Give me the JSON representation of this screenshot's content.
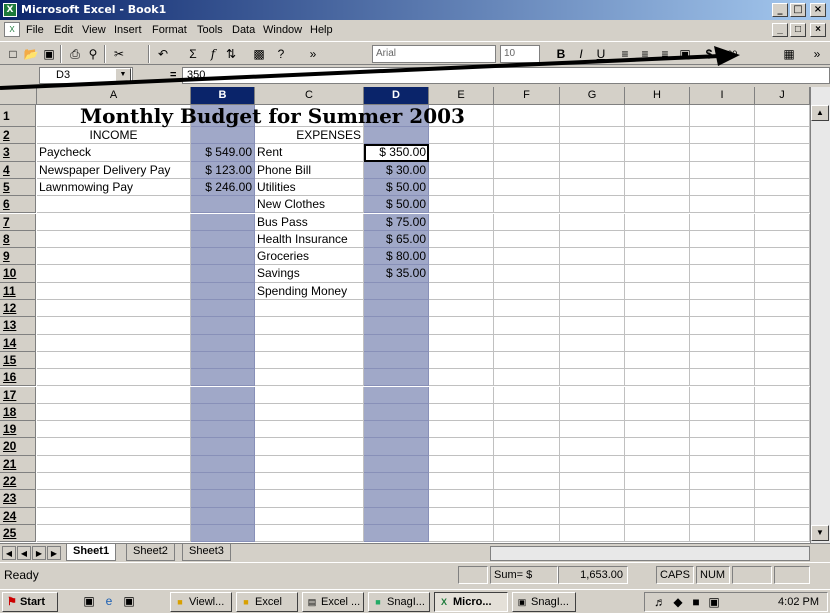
{
  "window": {
    "title": "Microsoft Excel - Book1",
    "controls": [
      "_",
      "□",
      "×"
    ]
  },
  "menu": {
    "items": [
      {
        "label": "File",
        "name": "menu-file"
      },
      {
        "label": "Edit",
        "name": "menu-edit"
      },
      {
        "label": "View",
        "name": "menu-view"
      },
      {
        "label": "Insert",
        "name": "menu-insert"
      },
      {
        "label": "Format",
        "name": "menu-format"
      },
      {
        "label": "Tools",
        "name": "menu-tools"
      },
      {
        "label": "Data",
        "name": "menu-data"
      },
      {
        "label": "Window",
        "name": "menu-window"
      },
      {
        "label": "Help",
        "name": "menu-help"
      }
    ]
  },
  "toolbar": {
    "font_name": "Arial",
    "font_size": "10",
    "currency_label": "$",
    "more_label": "»"
  },
  "formula_bar": {
    "name_box": "D3",
    "equals": "=",
    "value": "350"
  },
  "columns": [
    "A",
    "B",
    "C",
    "D",
    "E",
    "F",
    "G",
    "H",
    "I",
    "J"
  ],
  "selected_columns": [
    "B",
    "D"
  ],
  "rows": [
    "1",
    "2",
    "3",
    "4",
    "5",
    "6",
    "7",
    "8",
    "9",
    "10",
    "11",
    "12",
    "13",
    "14",
    "15",
    "16",
    "17",
    "18",
    "19",
    "20",
    "21",
    "22",
    "23",
    "24",
    "25"
  ],
  "sheet": {
    "title": "Monthly Budget for Summer 2003",
    "income_header": "INCOME",
    "expenses_header": "EXPENSES",
    "income": [
      {
        "label": "Paycheck",
        "amount": "$ 549.00"
      },
      {
        "label": "Newspaper Delivery Pay",
        "amount": "$ 123.00"
      },
      {
        "label": "Lawnmowing Pay",
        "amount": "$ 246.00"
      }
    ],
    "expenses": [
      {
        "label": "Rent",
        "amount": "$ 350.00"
      },
      {
        "label": "Phone Bill",
        "amount": "$ 30.00"
      },
      {
        "label": "Utilities",
        "amount": "$ 50.00"
      },
      {
        "label": "New Clothes",
        "amount": "$ 50.00"
      },
      {
        "label": "Bus Pass",
        "amount": "$ 75.00"
      },
      {
        "label": "Health Insurance",
        "amount": "$ 65.00"
      },
      {
        "label": "Groceries",
        "amount": "$ 80.00"
      },
      {
        "label": "Savings",
        "amount": "$ 35.00"
      },
      {
        "label": "Spending Money",
        "amount": ""
      }
    ]
  },
  "tabs": [
    {
      "label": "Sheet1",
      "active": true
    },
    {
      "label": "Sheet2",
      "active": false
    },
    {
      "label": "Sheet3",
      "active": false
    }
  ],
  "status": {
    "mode": "Ready",
    "sum_label": "Sum= $",
    "sum_value": "1,653.00",
    "caps": "CAPS",
    "num": "NUM"
  },
  "taskbar": {
    "start": "Start",
    "buttons": [
      {
        "label": "Viewl..."
      },
      {
        "label": "Excel"
      },
      {
        "label": "Excel ..."
      },
      {
        "label": "SnagI..."
      },
      {
        "label": "Micro...",
        "pressed": true
      },
      {
        "label": "SnagI..."
      }
    ],
    "clock": "4:02 PM"
  },
  "colors": {
    "title_bar": "#0a246a",
    "selected_column_fill": "#a0a8c8"
  }
}
